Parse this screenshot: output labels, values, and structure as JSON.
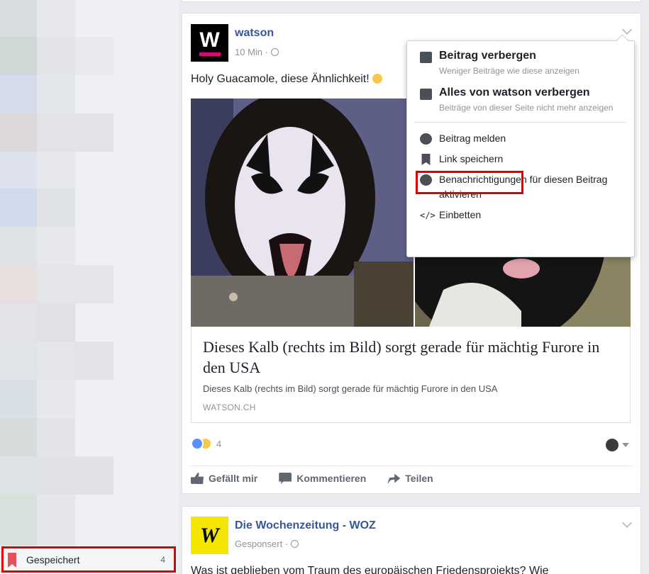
{
  "sidebar": {
    "saved_label": "Gespeichert",
    "saved_count": "4"
  },
  "post1": {
    "page_name": "watson",
    "time": "10 Min ·",
    "text": "Holy Guacamole, diese Ähnlichkeit!",
    "link_title": "Dieses Kalb (rechts im Bild) sorgt gerade für mächtig Furore in den USA",
    "link_description": "Dieses Kalb (rechts im Bild) sorgt gerade für mächtig Furore in den USA",
    "link_domain": "WATSON.CH",
    "reaction_count": "4",
    "actions": {
      "like": "Gefällt mir",
      "comment": "Kommentieren",
      "share": "Teilen"
    }
  },
  "menu": {
    "hide_post_title": "Beitrag verbergen",
    "hide_post_sub": "Weniger Beiträge wie diese anzeigen",
    "hide_all_title": "Alles von watson verbergen",
    "hide_all_sub": "Beiträge von dieser Seite nicht mehr anzeigen",
    "report": "Beitrag melden",
    "save_link": "Link speichern",
    "notifications": "Benachrichtigungen für diesen Beitrag aktivieren",
    "embed": "Einbetten"
  },
  "post2": {
    "page_name": "Die Wochenzeitung - WOZ",
    "sponsored": "Gesponsert ·",
    "text": "Was ist geblieben vom Traum des europäischen Friedensprojekts? Wie"
  },
  "colors": {
    "link_blue": "#365899",
    "highlight_red": "#e00000",
    "watson_pink": "#e4007c",
    "woz_yellow": "#f4e600"
  }
}
